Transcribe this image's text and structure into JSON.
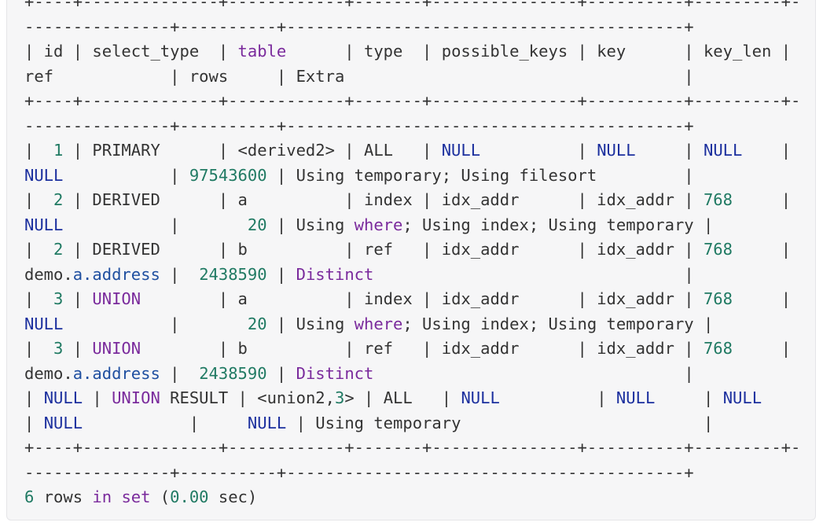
{
  "code_block": {
    "lines": [
      [
        {
          "t": "+----+--------------+------------+-------+---------------+----------+---------+-",
          "c": "tx"
        }
      ],
      [
        {
          "t": "---------------+----------+-----------------------------------------+",
          "c": "tx"
        }
      ],
      [
        {
          "t": "| id | select_type  | ",
          "c": "tx"
        },
        {
          "t": "table",
          "c": "kw"
        },
        {
          "t": "      | type  | possible_keys | key      | key_len |",
          "c": "tx"
        }
      ],
      [
        {
          "t": "ref            | rows     | Extra                                   |",
          "c": "tx"
        }
      ],
      [
        {
          "t": "+----+--------------+------------+-------+---------------+----------+---------+-",
          "c": "tx"
        }
      ],
      [
        {
          "t": "---------------+----------+-----------------------------------------+",
          "c": "tx"
        }
      ],
      [
        {
          "t": "|  ",
          "c": "tx"
        },
        {
          "t": "1",
          "c": "num"
        },
        {
          "t": " | PRIMARY      | <derived2> | ALL   | ",
          "c": "tx"
        },
        {
          "t": "NULL",
          "c": "nl"
        },
        {
          "t": "          | ",
          "c": "tx"
        },
        {
          "t": "NULL",
          "c": "nl"
        },
        {
          "t": "     | ",
          "c": "tx"
        },
        {
          "t": "NULL",
          "c": "nl"
        },
        {
          "t": "    |",
          "c": "tx"
        }
      ],
      [
        {
          "t": "NULL",
          "c": "nl"
        },
        {
          "t": "           | ",
          "c": "tx"
        },
        {
          "t": "97543600",
          "c": "num"
        },
        {
          "t": " | Using temporary; Using filesort         |",
          "c": "tx"
        }
      ],
      [
        {
          "t": "|  ",
          "c": "tx"
        },
        {
          "t": "2",
          "c": "num"
        },
        {
          "t": " | DERIVED      | a          | index | idx_addr      | idx_addr | ",
          "c": "tx"
        },
        {
          "t": "768",
          "c": "num"
        },
        {
          "t": "     |",
          "c": "tx"
        }
      ],
      [
        {
          "t": "NULL",
          "c": "nl"
        },
        {
          "t": "           |       ",
          "c": "tx"
        },
        {
          "t": "20",
          "c": "num"
        },
        {
          "t": " | Using ",
          "c": "tx"
        },
        {
          "t": "where",
          "c": "kw"
        },
        {
          "t": "; Using index; Using temporary |",
          "c": "tx"
        }
      ],
      [
        {
          "t": "|  ",
          "c": "tx"
        },
        {
          "t": "2",
          "c": "num"
        },
        {
          "t": " | DERIVED      | b          | ref   | idx_addr      | idx_addr | ",
          "c": "tx"
        },
        {
          "t": "768",
          "c": "num"
        },
        {
          "t": "     |",
          "c": "tx"
        }
      ],
      [
        {
          "t": "demo.",
          "c": "tx"
        },
        {
          "t": "a.address",
          "c": "ref"
        },
        {
          "t": " |  ",
          "c": "tx"
        },
        {
          "t": "2438590",
          "c": "num"
        },
        {
          "t": " | ",
          "c": "tx"
        },
        {
          "t": "Distinct",
          "c": "kw"
        },
        {
          "t": "                                |",
          "c": "tx"
        }
      ],
      [
        {
          "t": "|  ",
          "c": "tx"
        },
        {
          "t": "3",
          "c": "num"
        },
        {
          "t": " | ",
          "c": "tx"
        },
        {
          "t": "UNION",
          "c": "kw"
        },
        {
          "t": "        | a          | index | idx_addr      | idx_addr | ",
          "c": "tx"
        },
        {
          "t": "768",
          "c": "num"
        },
        {
          "t": "     |",
          "c": "tx"
        }
      ],
      [
        {
          "t": "NULL",
          "c": "nl"
        },
        {
          "t": "           |       ",
          "c": "tx"
        },
        {
          "t": "20",
          "c": "num"
        },
        {
          "t": " | Using ",
          "c": "tx"
        },
        {
          "t": "where",
          "c": "kw"
        },
        {
          "t": "; Using index; Using temporary |",
          "c": "tx"
        }
      ],
      [
        {
          "t": "|  ",
          "c": "tx"
        },
        {
          "t": "3",
          "c": "num"
        },
        {
          "t": " | ",
          "c": "tx"
        },
        {
          "t": "UNION",
          "c": "kw"
        },
        {
          "t": "        | b          | ref   | idx_addr      | idx_addr | ",
          "c": "tx"
        },
        {
          "t": "768",
          "c": "num"
        },
        {
          "t": "     |",
          "c": "tx"
        }
      ],
      [
        {
          "t": "demo.",
          "c": "tx"
        },
        {
          "t": "a.address",
          "c": "ref"
        },
        {
          "t": " |  ",
          "c": "tx"
        },
        {
          "t": "2438590",
          "c": "num"
        },
        {
          "t": " | ",
          "c": "tx"
        },
        {
          "t": "Distinct",
          "c": "kw"
        },
        {
          "t": "                                |",
          "c": "tx"
        }
      ],
      [
        {
          "t": "| ",
          "c": "tx"
        },
        {
          "t": "NULL",
          "c": "nl"
        },
        {
          "t": " | ",
          "c": "tx"
        },
        {
          "t": "UNION",
          "c": "kw"
        },
        {
          "t": " RESULT | <union2,",
          "c": "tx"
        },
        {
          "t": "3",
          "c": "num"
        },
        {
          "t": "> | ALL   | ",
          "c": "tx"
        },
        {
          "t": "NULL",
          "c": "nl"
        },
        {
          "t": "          | ",
          "c": "tx"
        },
        {
          "t": "NULL",
          "c": "nl"
        },
        {
          "t": "     | ",
          "c": "tx"
        },
        {
          "t": "NULL",
          "c": "nl"
        }
      ],
      [
        {
          "t": "| ",
          "c": "tx"
        },
        {
          "t": "NULL",
          "c": "nl"
        },
        {
          "t": "           |     ",
          "c": "tx"
        },
        {
          "t": "NULL",
          "c": "nl"
        },
        {
          "t": " | Using temporary                         |",
          "c": "tx"
        }
      ],
      [
        {
          "t": "+----+--------------+------------+-------+---------------+----------+---------+-",
          "c": "tx"
        }
      ],
      [
        {
          "t": "---------------+----------+-----------------------------------------+",
          "c": "tx"
        }
      ],
      [
        {
          "t": "6",
          "c": "num"
        },
        {
          "t": " rows ",
          "c": "tx"
        },
        {
          "t": "in",
          "c": "kw"
        },
        {
          "t": " ",
          "c": "tx"
        },
        {
          "t": "set",
          "c": "kw"
        },
        {
          "t": " (",
          "c": "tx"
        },
        {
          "t": "0.00",
          "c": "num"
        },
        {
          "t": " sec)",
          "c": "tx"
        }
      ]
    ]
  }
}
